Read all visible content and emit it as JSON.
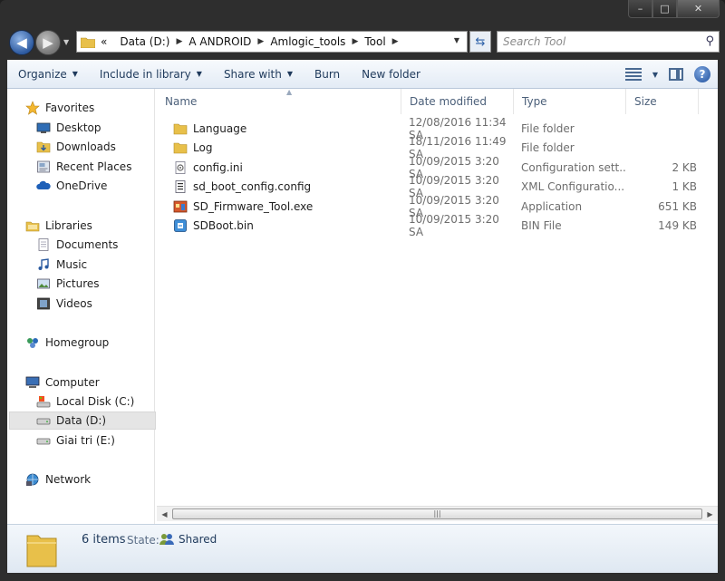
{
  "window": {
    "caption_buttons": {
      "minimize": "–",
      "maximize": "□",
      "close": "✕"
    }
  },
  "address_bar": {
    "overflow": "«",
    "breadcrumbs": [
      "Data (D:)",
      "A ANDROID",
      "Amlogic_tools",
      "Tool"
    ]
  },
  "search": {
    "placeholder": "Search Tool"
  },
  "toolbar": {
    "organize": "Organize",
    "include_in_library": "Include in library",
    "share_with": "Share with",
    "burn": "Burn",
    "new_folder": "New folder"
  },
  "sidebar": {
    "favorites": "Favorites",
    "desktop": "Desktop",
    "downloads": "Downloads",
    "recent_places": "Recent Places",
    "onedrive": "OneDrive",
    "libraries": "Libraries",
    "documents": "Documents",
    "music": "Music",
    "pictures": "Pictures",
    "videos": "Videos",
    "homegroup": "Homegroup",
    "computer": "Computer",
    "local_disk": "Local Disk (C:)",
    "data_d": "Data (D:)",
    "giai_tri": "Giai tri (E:)",
    "network": "Network"
  },
  "columns": {
    "name": "Name",
    "date": "Date modified",
    "type": "Type",
    "size": "Size"
  },
  "files": [
    {
      "name": "Language",
      "date": "12/08/2016 11:34 SA",
      "type": "File folder",
      "size": "",
      "icon": "folder-icon"
    },
    {
      "name": "Log",
      "date": "18/11/2016 11:49 SA",
      "type": "File folder",
      "size": "",
      "icon": "folder-icon"
    },
    {
      "name": "config.ini",
      "date": "10/09/2015 3:20 SA",
      "type": "Configuration sett...",
      "size": "2 KB",
      "icon": "config-file-icon"
    },
    {
      "name": "sd_boot_config.config",
      "date": "10/09/2015 3:20 SA",
      "type": "XML Configuratio...",
      "size": "1 KB",
      "icon": "xml-config-icon"
    },
    {
      "name": "SD_Firmware_Tool.exe",
      "date": "10/09/2015 3:20 SA",
      "type": "Application",
      "size": "651 KB",
      "icon": "application-icon"
    },
    {
      "name": "SDBoot.bin",
      "date": "10/09/2015 3:20 SA",
      "type": "BIN File",
      "size": "149 KB",
      "icon": "bin-file-icon"
    }
  ],
  "details_pane": {
    "count": "6 items",
    "state_label": "State:",
    "state_value": "Shared"
  },
  "colors": {
    "accent": "#1e395b",
    "folder": "#e8c04a",
    "selection": "#e5e5e5"
  }
}
